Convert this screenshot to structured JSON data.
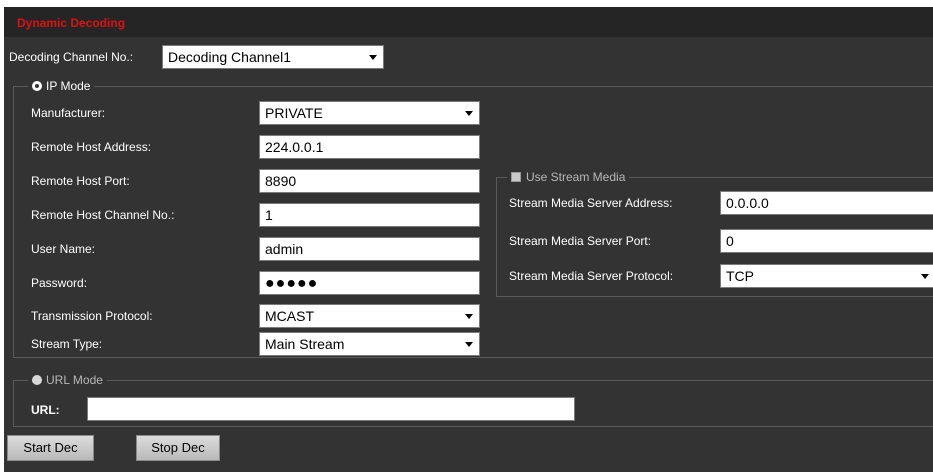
{
  "title": "Dynamic Decoding",
  "decoding_channel": {
    "label": "Decoding Channel No.:",
    "value": "Decoding Channel1"
  },
  "ip_mode": {
    "legend": "IP Mode",
    "selected": true,
    "fields": [
      {
        "label": "Manufacturer:",
        "value": "PRIVATE",
        "type": "select"
      },
      {
        "label": "Remote Host Address:",
        "value": "224.0.0.1",
        "type": "text"
      },
      {
        "label": "Remote Host Port:",
        "value": "8890",
        "type": "text"
      },
      {
        "label": "Remote Host Channel No.:",
        "value": "1",
        "type": "text"
      },
      {
        "label": "User Name:",
        "value": "admin",
        "type": "text"
      },
      {
        "label": "Password:",
        "value": "●●●●●",
        "type": "password"
      },
      {
        "label": "Transmission Protocol:",
        "value": "MCAST",
        "type": "select"
      },
      {
        "label": "Stream Type:",
        "value": "Main Stream",
        "type": "select"
      }
    ]
  },
  "stream_media": {
    "legend": "Use Stream Media",
    "checked": false,
    "server_address": {
      "label": "Stream Media Server Address:",
      "value": "0.0.0.0"
    },
    "server_port": {
      "label": "Stream Media Server Port:",
      "value": "0"
    },
    "server_protocol": {
      "label": "Stream Media Server Protocol:",
      "value": "TCP"
    }
  },
  "url_mode": {
    "legend": "URL Mode",
    "selected": false,
    "url_label": "URL:",
    "url_value": ""
  },
  "buttons": {
    "start": "Start Dec",
    "stop": "Stop Dec"
  },
  "colors": {
    "title_red": "#dd1111",
    "panel_bg": "#333333",
    "title_bar_bg": "#252525"
  }
}
